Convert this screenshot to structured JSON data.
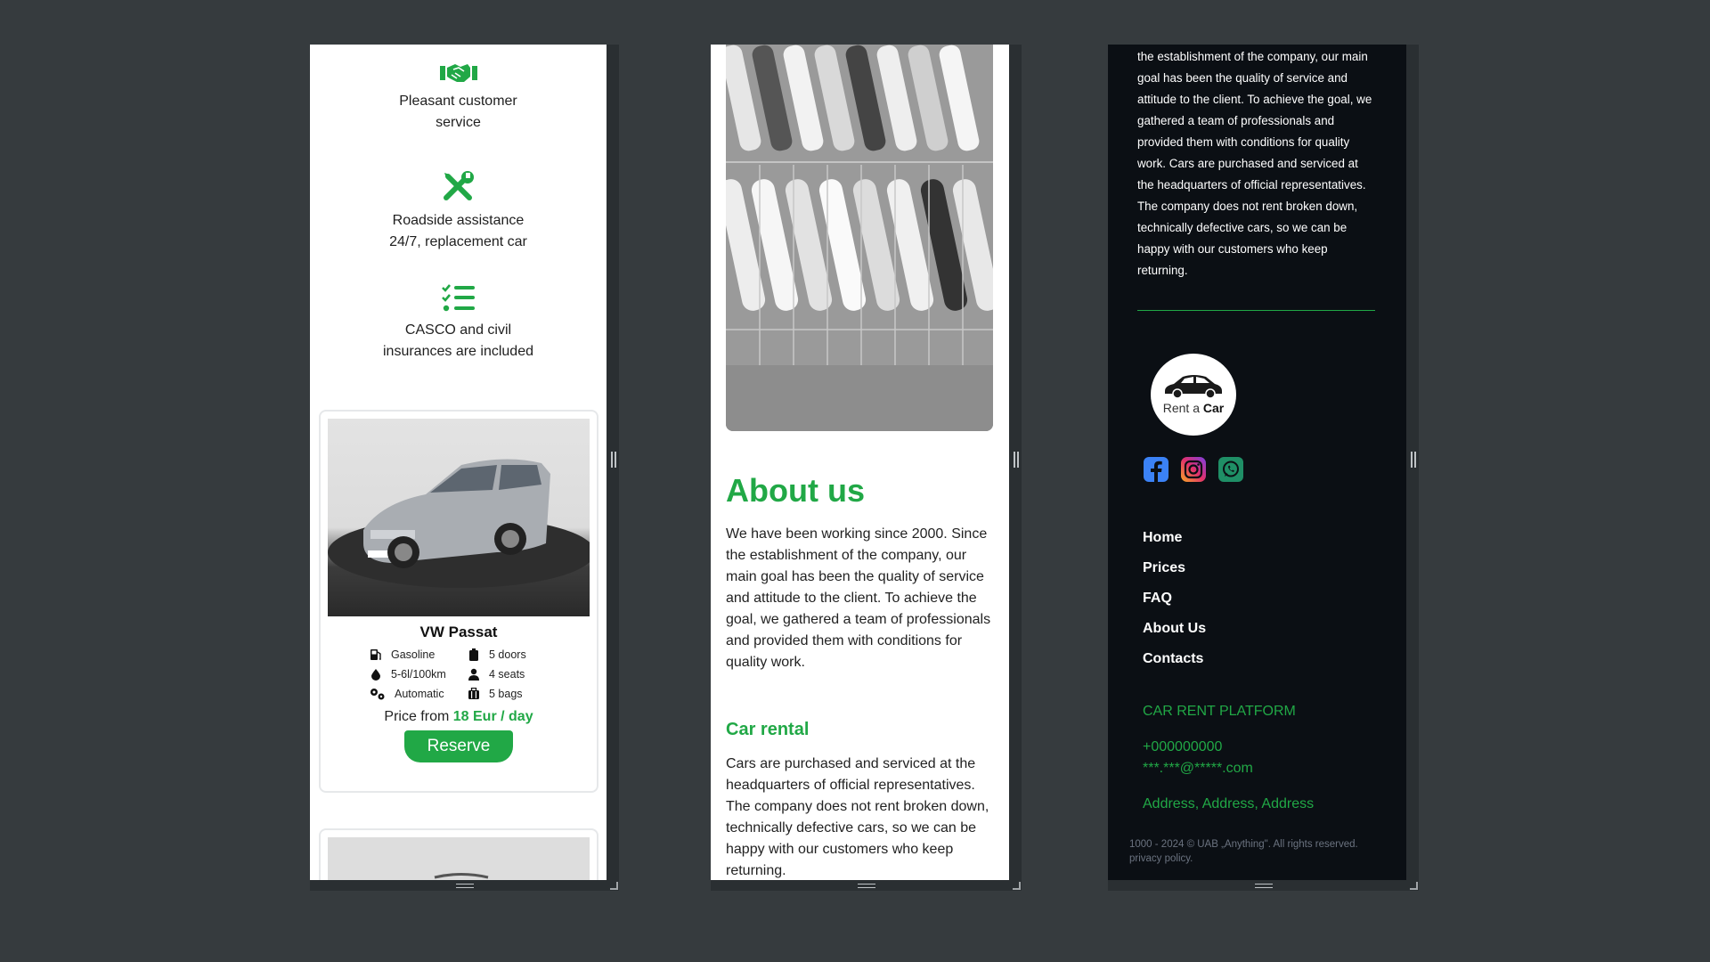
{
  "features": [
    {
      "icon": "handshake-icon",
      "text": [
        "Pleasant customer",
        "service"
      ]
    },
    {
      "icon": "tools-icon",
      "text": [
        "Roadside assistance",
        "24/7, replacement car"
      ]
    },
    {
      "icon": "checklist-icon",
      "text": [
        "CASCO and civil",
        "insurances are included"
      ]
    }
  ],
  "car": {
    "title": "VW Passat",
    "specs": [
      {
        "icon": "fuel-icon",
        "label": "Gasoline"
      },
      {
        "icon": "door-icon",
        "label": "5 doors"
      },
      {
        "icon": "drop-icon",
        "label": "5-6l/100km"
      },
      {
        "icon": "person-icon",
        "label": "4 seats"
      },
      {
        "icon": "gears-icon",
        "label": "Automatic"
      },
      {
        "icon": "luggage-icon",
        "label": "5 bags"
      }
    ],
    "price_prefix": "Price from",
    "price_value": "18 Eur / day",
    "reserve_label": "Reserve"
  },
  "about": {
    "heading": "About us",
    "paragraph": "We have been working since 2000. Since the establishment of the company, our main goal has been the quality of service and attitude to the client. To achieve the goal, we gathered a team of professionals and provided them with conditions for quality work.",
    "sub_heading": "Car rental",
    "sub_paragraph": "Cars are purchased and serviced at the headquarters of official representatives. The company does not rent broken down, technically defective cars, so we can be happy with our customers who keep returning."
  },
  "footer": {
    "about_text": "the establishment of the company, our main goal has been the quality of service and attitude to the client. To achieve the goal, we gathered a team of professionals and provided them with conditions for quality work. Cars are purchased and serviced at the headquarters of official representatives. The company does not rent broken down, technically defective cars, so we can be happy with our customers who keep returning.",
    "logo_text_a": "Rent a",
    "logo_text_b": "Car",
    "socials": [
      "facebook-icon",
      "instagram-icon",
      "whatsapp-icon"
    ],
    "nav": [
      "Home",
      "Prices",
      "FAQ",
      "About Us",
      "Contacts"
    ],
    "platform": "CAR RENT PLATFORM",
    "phone": "+000000000",
    "email": "***.***@*****.com",
    "address": "Address, Address, Address",
    "copyright": "1000 - 2024 © UAB „Anything\". All rights reserved.",
    "privacy": "privacy policy."
  },
  "colors": {
    "accent": "#21a846",
    "page_bg": "#363b3e",
    "footer_bg": "#0b0f14"
  }
}
